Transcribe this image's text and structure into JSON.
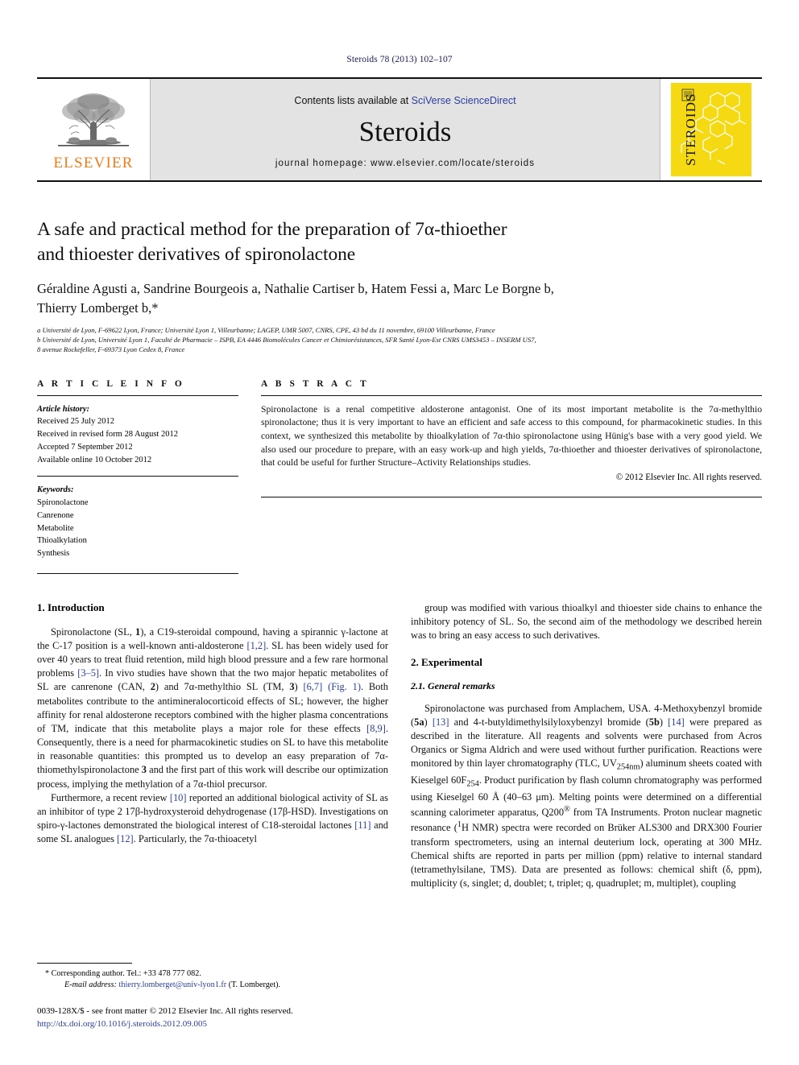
{
  "running_head": "Steroids 78 (2013) 102–107",
  "masthead": {
    "publisher_name": "ELSEVIER",
    "contents_prefix": "Contents lists available at ",
    "contents_link": "SciVerse ScienceDirect",
    "journal_title": "Steroids",
    "homepage": "journal homepage: www.elsevier.com/locate/steroids",
    "cover_title": "STEROIDS",
    "link_color": "#2a3ea0",
    "elsevier_orange": "#f07c1a",
    "cover_yellow": "#f5d913"
  },
  "article": {
    "title_line1": "A safe and practical method for the preparation of 7α-thioether",
    "title_line2": "and thioester derivatives of spironolactone",
    "authors_line1": "Géraldine Agusti a, Sandrine Bourgeois a, Nathalie Cartiser b, Hatem Fessi a, Marc Le Borgne b,",
    "authors_line2": "Thierry Lomberget b,*",
    "affiliations": [
      "a Université de Lyon, F-69622 Lyon, France; Université Lyon 1, Villeurbanne; LAGEP, UMR 5007, CNRS, CPE, 43 bd du 11 novembre, 69100 Villeurbanne, France",
      "b Université de Lyon, Université Lyon 1, Faculté de Pharmacie – ISPB, EA 4446 Biomolécules Cancer et Chimiorésistances, SFR Santé Lyon-Est CNRS UMS3453 – INSERM US7,",
      "8 avenue Rockefeller, F-69373 Lyon Cedex 8, France"
    ]
  },
  "article_info": {
    "heading": "A R T I C L E   I N F O",
    "history_label": "Article history:",
    "history": [
      "Received 25 July 2012",
      "Received in revised form 28 August 2012",
      "Accepted 7 September 2012",
      "Available online 10 October 2012"
    ],
    "keywords_label": "Keywords:",
    "keywords": [
      "Spironolactone",
      "Canrenone",
      "Metabolite",
      "Thioalkylation",
      "Synthesis"
    ]
  },
  "abstract": {
    "heading": "A B S T R A C T",
    "text": "Spironolactone is a renal competitive aldosterone antagonist. One of its most important metabolite is the 7α-methylthio spironolactone; thus it is very important to have an efficient and safe access to this compound, for pharmacokinetic studies. In this context, we synthesized this metabolite by thioalkylation of 7α-thio spironolactone using Hünig's base with a very good yield. We also used our procedure to prepare, with an easy work-up and high yields, 7α-thioether and thioester derivatives of spironolactone, that could be useful for further Structure–Activity Relationships studies.",
    "copyright": "© 2012 Elsevier Inc. All rights reserved."
  },
  "body": {
    "left": {
      "section_heading": "1. Introduction",
      "paragraph1_parts": [
        "Spironolactone (SL, ",
        "1",
        "), a C19-steroidal compound, having a spirannic γ-lactone at the C-17 position is a well-known anti-aldosterone ",
        "[1,2]",
        ". SL has been widely used for over 40 years to treat fluid retention, mild high blood pressure and a few rare hormonal problems ",
        "[3–5]",
        ". In vivo studies have shown that the two major hepatic metabolites of SL are canrenone (CAN, ",
        "2",
        ") and 7α-methylthio SL (TM, ",
        "3",
        ") ",
        "[6,7]",
        " ",
        "(Fig. 1)",
        ". Both metabolites contribute to the antimineralocorticoid effects of SL; however, the higher affinity for renal aldosterone receptors combined with the higher plasma concentrations of TM, indicate that this metabolite plays a major role for these effects ",
        "[8,9]",
        ". Consequently, there is a need for pharmacokinetic studies on SL to have this metabolite in reasonable quantities: this prompted us to develop an easy preparation of 7α-thiomethylspironolactone ",
        "3",
        " and the first part of this work will describe our optimization process, implying the methylation of a 7α-thiol precursor."
      ],
      "paragraph2_parts": [
        "Furthermore, a recent review ",
        "[10]",
        " reported an additional biological activity of SL as an inhibitor of type 2 17β-hydroxysteroid dehydrogenase (17β-HSD). Investigations on spiro-γ-lactones demonstrated the biological interest of C18-steroidal lactones ",
        "[11]",
        " and some SL analogues ",
        "[12]",
        ". Particularly, the 7α-thioacetyl"
      ]
    },
    "right": {
      "paragraph_continued": "group was modified with various thioalkyl and thioester side chains to enhance the inhibitory potency of SL. So, the second aim of the methodology we described herein was to bring an easy access to such derivatives.",
      "section_heading": "2. Experimental",
      "subsection_heading": "2.1. General remarks",
      "paragraph_parts": [
        "Spironolactone was purchased from Amplachem, USA. 4-Methoxybenzyl bromide (",
        "5a",
        ") ",
        "[13]",
        " and 4-t-butyldimethylsilyloxybenzyl bromide (",
        "5b",
        ") ",
        "[14]",
        " were prepared as described in the literature. All reagents and solvents were purchased from Acros Organics or Sigma Aldrich and were used without further purification. Reactions were monitored by thin layer chromatography (TLC, UV",
        "254nm",
        ") aluminum sheets coated with Kieselgel 60F",
        "254",
        ". Product purification by flash column chromatography was performed using Kieselgel 60 Å (40–63 μm). Melting points were determined on a differential scanning calorimeter apparatus, Q200",
        "®",
        " from TA Instruments. Proton nuclear magnetic resonance (",
        "1",
        "H NMR) spectra were recorded on Brüker ALS300 and DRX300 Fourier transform spectrometers, using an internal deuterium lock, operating at 300 MHz. Chemical shifts are reported in parts per million (ppm) relative to internal standard (tetramethylsilane, TMS). Data are presented as follows: chemical shift (δ, ppm), multiplicity (s, singlet; d, doublet; t, triplet; q, quadruplet; m, multiplet), coupling"
      ]
    }
  },
  "footnotes": {
    "corresponding_marker": "*",
    "corresponding_text": "Corresponding author. Tel.: +33 478 777 082.",
    "email_label": "E-mail address:",
    "email": "thierry.lomberget@univ-lyon1.fr",
    "email_suffix": "(T. Lomberget).",
    "issn_line": "0039-128X/$ - see front matter © 2012 Elsevier Inc. All rights reserved.",
    "doi": "http://dx.doi.org/10.1016/j.steroids.2012.09.005"
  }
}
